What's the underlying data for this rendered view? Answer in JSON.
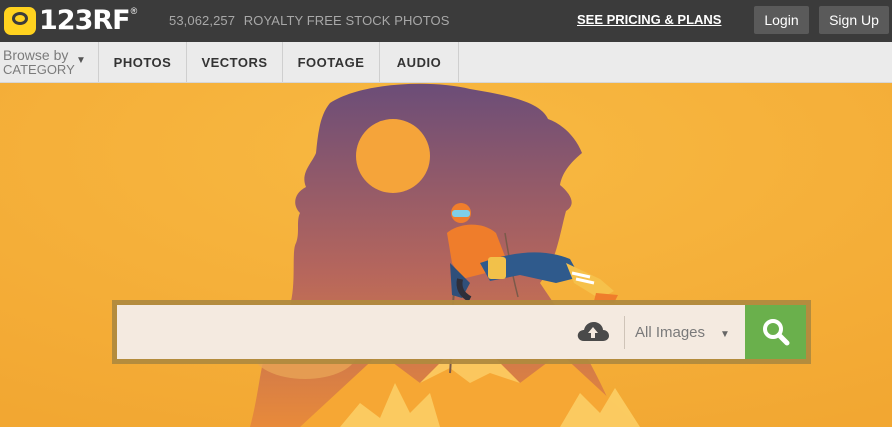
{
  "header": {
    "logo_text": "123RF",
    "logo_reg": "®",
    "photo_count": "53,062,257",
    "tagline": "ROYALTY FREE STOCK PHOTOS",
    "pricing_link": "SEE PRICING & PLANS",
    "login_label": "Login",
    "signup_label": "Sign Up"
  },
  "nav": {
    "browse_line1": "Browse by",
    "browse_line2": "CATEGORY",
    "browse_caret": "▼",
    "items": [
      {
        "label": "PHOTOS"
      },
      {
        "label": "VECTORS"
      },
      {
        "label": "FOOTAGE"
      },
      {
        "label": "AUDIO"
      }
    ]
  },
  "search": {
    "value": "",
    "placeholder": "",
    "scope_label": "All Images",
    "scope_caret": "▼"
  },
  "colors": {
    "topbar": "#3b3b3b",
    "logo_yellow": "#ffd21f",
    "hero_orange": "#f6b23a",
    "silhouette_purple": "#6e5077",
    "search_green": "#6ab04c"
  },
  "icons": [
    "logo-camera-icon",
    "dropdown-caret-icon",
    "upload-cloud-icon",
    "search-icon"
  ]
}
